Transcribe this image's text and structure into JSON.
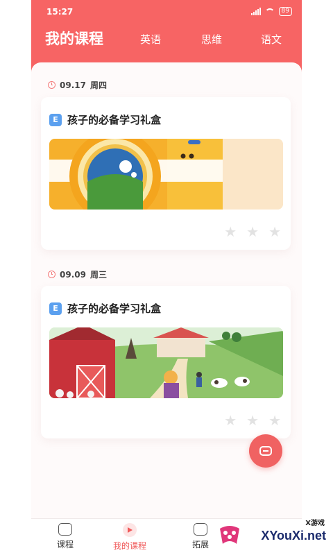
{
  "status": {
    "time": "15:27",
    "battery": "89"
  },
  "tabs": {
    "active": "我的课程",
    "items": [
      "英语",
      "思维",
      "语文"
    ]
  },
  "cards": [
    {
      "date": "09.17",
      "weekday": "周四",
      "title": "孩子的必备学习礼盒",
      "badge": "E",
      "image": "camera-illustration",
      "stars": 3
    },
    {
      "date": "09.09",
      "weekday": "周三",
      "title": "孩子的必备学习礼盒",
      "badge": "E",
      "image": "farm-illustration",
      "stars": 3
    }
  ],
  "bottom_nav": [
    {
      "label": "课程",
      "icon": "bookmark-icon"
    },
    {
      "label": "我的课程",
      "icon": "play-icon",
      "active": true
    },
    {
      "label": "拓展",
      "icon": "compass-icon"
    }
  ],
  "watermark": {
    "text": "XYouXi.net",
    "sub": "X游戏"
  },
  "colors": {
    "accent": "#f76464",
    "badge": "#5ba0ef",
    "fab": "#f06262"
  }
}
